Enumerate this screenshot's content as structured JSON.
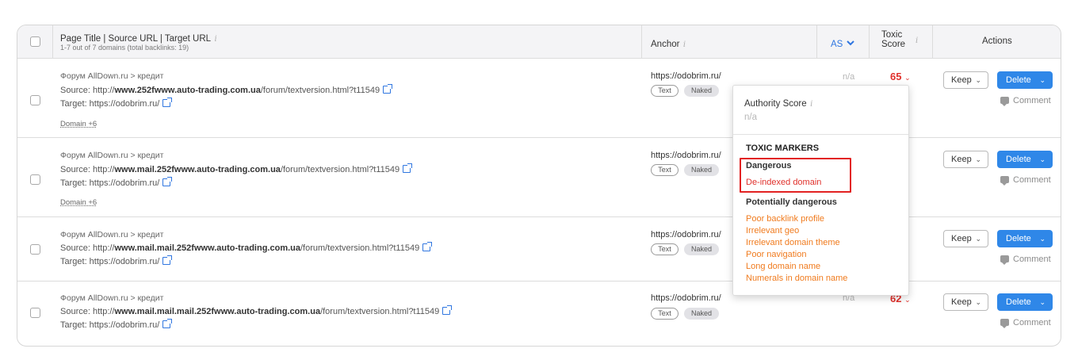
{
  "header": {
    "col_title": "Page Title | Source URL | Target URL",
    "col_subtitle": "1-7 out of 7 domains (total backlinks: 19)",
    "col_anchor": "Anchor",
    "col_as": "AS",
    "col_toxic_line1": "Toxic",
    "col_toxic_line2": "Score",
    "col_actions": "Actions",
    "info_glyph": "i"
  },
  "rows": [
    {
      "title": "Форум AllDown.ru > кредит",
      "source_prefix": "Source: http://",
      "source_bold": "www.252fwww.auto-trading.com.ua",
      "source_suffix": "/forum/textversion.html?t11549",
      "target": "Target: https://odobrim.ru/",
      "domain_more": "Domain +6",
      "anchor": "https://odobrim.ru/",
      "tag1": "Text",
      "tag2": "Naked",
      "as": "n/a",
      "toxic": "65",
      "keep": "Keep",
      "delete": "Delete",
      "comment": "Comment"
    },
    {
      "title": "Форум AllDown.ru > кредит",
      "source_prefix": "Source: http://",
      "source_bold": "www.mail.252fwww.auto-trading.com.ua",
      "source_suffix": "/forum/textversion.html?t11549",
      "target": "Target: https://odobrim.ru/",
      "domain_more": "Domain +6",
      "anchor": "https://odobrim.ru/",
      "tag1": "Text",
      "tag2": "Naked",
      "keep": "Keep",
      "delete": "Delete",
      "comment": "Comment"
    },
    {
      "title": "Форум AllDown.ru > кредит",
      "source_prefix": "Source: http://",
      "source_bold": "www.mail.mail.252fwww.auto-trading.com.ua",
      "source_suffix": "/forum/textversion.html?t11549",
      "target": "Target: https://odobrim.ru/",
      "anchor": "https://odobrim.ru/",
      "tag1": "Text",
      "tag2": "Naked",
      "keep": "Keep",
      "delete": "Delete",
      "comment": "Comment"
    },
    {
      "title": "Форум AllDown.ru > кредит",
      "source_prefix": "Source: http://",
      "source_bold": "www.mail.mail.mail.252fwww.auto-trading.com.ua",
      "source_suffix": "/forum/textversion.html?t11549",
      "target": "Target: https://odobrim.ru/",
      "anchor": "https://odobrim.ru/",
      "tag1": "Text",
      "tag2": "Naked",
      "as": "n/a",
      "toxic": "62",
      "keep": "Keep",
      "delete": "Delete",
      "comment": "Comment"
    }
  ],
  "popup": {
    "authority_label": "Authority Score",
    "authority_value": "n/a",
    "markers_heading": "TOXIC MARKERS",
    "dangerous_label": "Dangerous",
    "dangerous_items": [
      "De-indexed domain"
    ],
    "potential_label": "Potentially dangerous",
    "potential_items": [
      "Poor backlink profile",
      "Irrelevant geo",
      "Irrelevant domain theme",
      "Poor navigation",
      "Long domain name",
      "Numerals in domain name"
    ]
  },
  "colors": {
    "accent_blue": "#2f87e8",
    "toxic_red": "#e0302b",
    "marker_orange": "#f07b1e",
    "highlight_red": "#e22222"
  }
}
